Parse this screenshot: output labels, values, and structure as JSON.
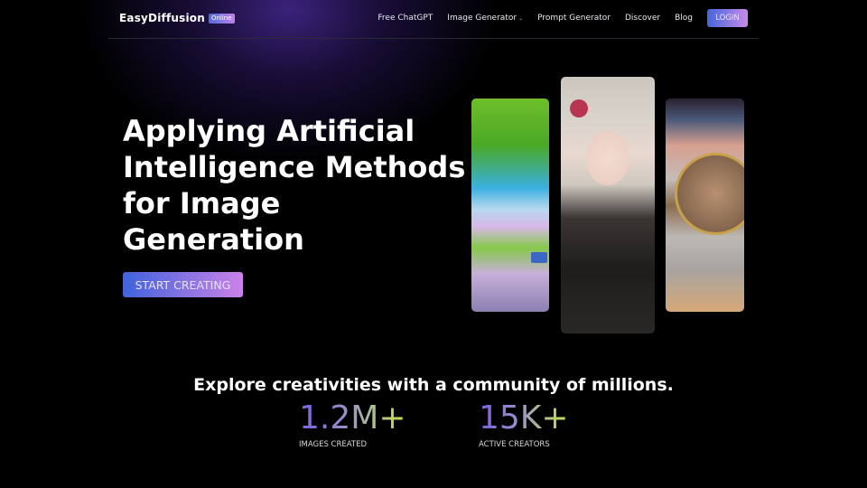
{
  "nav": {
    "logo_text": "EasyDiffusion",
    "logo_badge": "Online",
    "items": [
      {
        "label": "Free ChatGPT"
      },
      {
        "label": "Image Generator",
        "has_dropdown": true
      },
      {
        "label": "Prompt Generator"
      },
      {
        "label": "Discover"
      },
      {
        "label": "Blog"
      }
    ],
    "login_label": "LOGIN"
  },
  "hero": {
    "title": "Applying Artificial Intelligence Methods for Image Generation",
    "cta_label": "START CREATING",
    "images": [
      {
        "subject": "Anime road scene with trees and blue car"
      },
      {
        "subject": "Anime girl with silver hair and red flower"
      },
      {
        "subject": "Cat in astronaut suit in space"
      }
    ]
  },
  "community": {
    "tagline": "Explore creativities with a community of millions.",
    "stats": [
      {
        "value": "1.2M+",
        "label": "IMAGES CREATED"
      },
      {
        "value": "15K+",
        "label": "ACTIVE CREATORS"
      }
    ]
  },
  "colors": {
    "accent_start": "#4466dd",
    "accent_end": "#c88be6",
    "background": "#000000"
  }
}
